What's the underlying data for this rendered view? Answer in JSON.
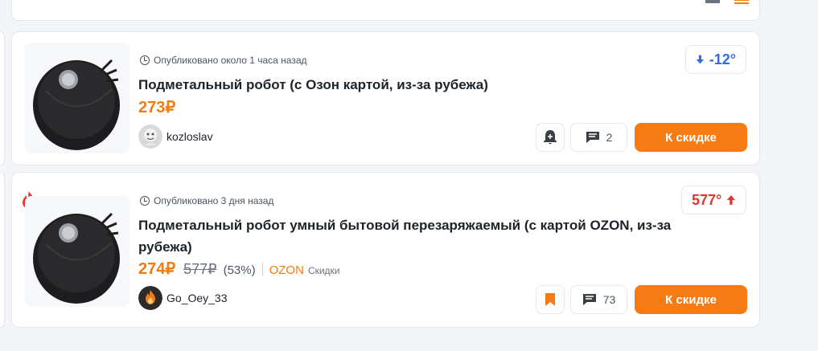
{
  "colors": {
    "accent": "#f57c14",
    "price": "#f07c10",
    "temp_cold": "#2f6ee0",
    "temp_hot": "#e0372f",
    "card_bg": "#ffffff",
    "page_bg": "#f3f5f9"
  },
  "toolbar": {
    "icons": [
      "list-view-icon",
      "compact-view-icon"
    ]
  },
  "deals": [
    {
      "published": "Опубликовано около 1 часа назад",
      "title": "Подметальный робот (с Озон картой, из-за рубежа)",
      "price": "273₽",
      "author": "kozloslav",
      "temperature": "-12°",
      "temperature_icon": "arrow-down-icon",
      "comments": "2",
      "action_icon": "bell-icon",
      "deal_button": "К скидке"
    },
    {
      "published": "Опубликовано 3 дня назад",
      "title": "Подметальный робот умный бытовой перезаряжаемый (с картой OZON, из-за рубежа)",
      "price": "274₽",
      "old_price": "577₽",
      "discount": "(53%)",
      "shop": "OZON",
      "shop_sub": "Скидки",
      "author": "Go_Oey_33",
      "temperature": "577°",
      "temperature_icon": "arrow-up-icon",
      "comments": "73",
      "action_icon": "bookmark-icon",
      "hot_icon": "fire-icon",
      "deal_button": "К скидке"
    }
  ]
}
